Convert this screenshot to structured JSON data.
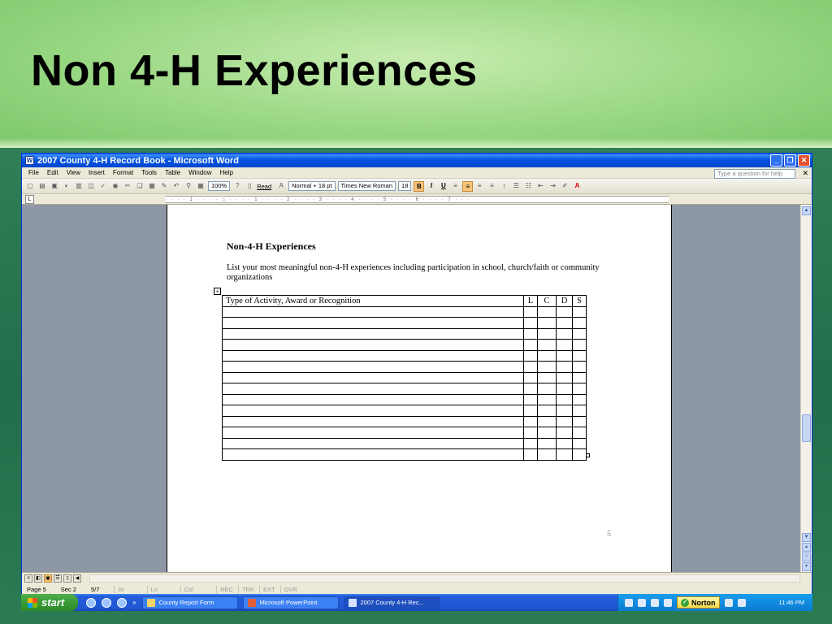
{
  "slide": {
    "title": "Non 4-H Experiences"
  },
  "window": {
    "title": "2007 County 4-H Record Book - Microsoft Word"
  },
  "menu": {
    "items": [
      "File",
      "Edit",
      "View",
      "Insert",
      "Format",
      "Tools",
      "Table",
      "Window",
      "Help"
    ],
    "ask_placeholder": "Type a question for help"
  },
  "toolbar": {
    "zoom": "100%",
    "read": "Read",
    "style": "Normal + 18 pt",
    "font": "Times New Roman",
    "size": "18",
    "bold": "B",
    "italic": "I",
    "underline": "U"
  },
  "document": {
    "heading": "Non-4-H Experiences",
    "intro": "List your most meaningful non-4-H experiences including participation in school, church/faith or community organizations",
    "table_headers": [
      "Type of Activity, Award or Recognition",
      "L",
      "C",
      "D",
      "S"
    ],
    "empty_rows": 14,
    "page_number": "5"
  },
  "status": {
    "page": "Page 5",
    "sec": "Sec 2",
    "pages": "5/7",
    "at": "At",
    "ln": "Ln",
    "col": "Col",
    "rec": "REC",
    "trk": "TRK",
    "ext": "EXT",
    "ovr": "OVR"
  },
  "taskbar": {
    "start": "start",
    "buttons": [
      "County Report Form",
      "Microsoft PowerPoint",
      "2007 County 4-H Rec..."
    ],
    "norton": "Norton",
    "clock": "11:46 PM"
  },
  "colors": {
    "titlebar": "#0454e0",
    "workarea": "#8e97a6",
    "taskbar": "#245edb",
    "start": "#3a9b36"
  }
}
